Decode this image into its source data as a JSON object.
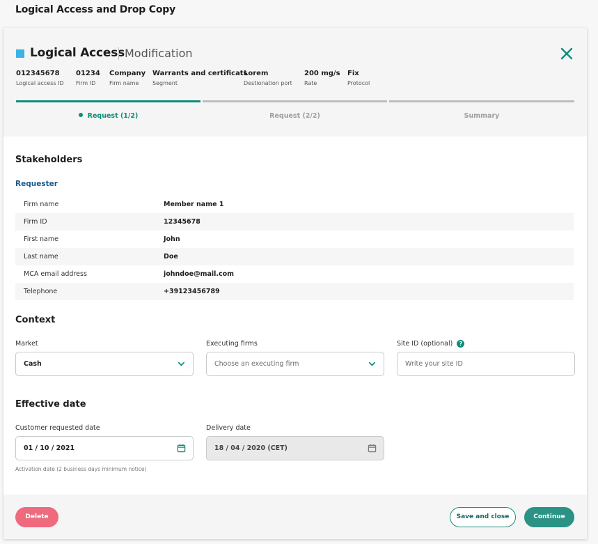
{
  "page": {
    "title": "Logical Access and Drop Copy"
  },
  "modal": {
    "title": "Logical Access",
    "subtitle": "Modification",
    "meta": [
      {
        "value": "012345678",
        "label": "Logical access ID"
      },
      {
        "value": "01234",
        "label": "Firm ID"
      },
      {
        "value": "Company",
        "label": "Firm name"
      },
      {
        "value": "Warrants and certificats",
        "label": "Segment"
      },
      {
        "value": "Lorem",
        "label": "Destionation port"
      },
      {
        "value": "200 mg/s",
        "label": "Rate"
      },
      {
        "value": "Fix",
        "label": "Protocol"
      }
    ],
    "steps": [
      {
        "label": "Request (1/2)",
        "state": "active"
      },
      {
        "label": "Request (2/2)",
        "state": "inactive"
      },
      {
        "label": "Summary",
        "state": "inactive"
      }
    ]
  },
  "stakeholders": {
    "title": "Stakeholders",
    "requester_title": "Requester",
    "rows": [
      {
        "key": "Firm name",
        "value": "Member name 1"
      },
      {
        "key": "Firm ID",
        "value": "12345678"
      },
      {
        "key": "First name",
        "value": "John"
      },
      {
        "key": "Last name",
        "value": "Doe"
      },
      {
        "key": "MCA email address",
        "value": "johndoe@mail.com"
      },
      {
        "key": "Telephone",
        "value": "+39123456789"
      }
    ]
  },
  "context": {
    "title": "Context",
    "market": {
      "label": "Market",
      "value": "Cash"
    },
    "executing_firms": {
      "label": "Executing firms",
      "placeholder": "Choose an executing firm"
    },
    "site_id": {
      "label": "Site ID (optional)",
      "placeholder": "Write your site ID",
      "help": "?"
    }
  },
  "effective_date": {
    "title": "Effective date",
    "customer_requested": {
      "label": "Customer requested date",
      "value": "01 / 10 / 2021",
      "hint": "Activation date (2 business days minimum notice)"
    },
    "delivery": {
      "label": "Delivery date",
      "value": "18 / 04 / 2020 (CET)"
    }
  },
  "footer": {
    "delete_label": "Delete",
    "save_label": "Save and close",
    "continue_label": "Continue"
  },
  "colors": {
    "accent": "#0f8b7b",
    "title_square": "#3bb3e6",
    "link_blue": "#1b5b8d",
    "delete": "#ef6a7d",
    "continue": "#2a9385"
  },
  "icons": {
    "close": "close-icon",
    "dropdown": "chevron-down-icon",
    "calendar": "calendar-icon",
    "help": "help-icon"
  }
}
